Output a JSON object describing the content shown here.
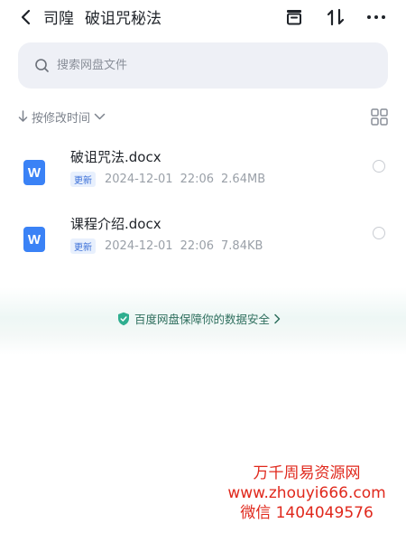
{
  "header": {
    "title_parts": [
      "司隍",
      "破诅咒秘法"
    ],
    "icons": [
      "back-icon",
      "archive-box-icon",
      "sort-arrows-icon",
      "more-icon"
    ]
  },
  "search": {
    "placeholder": "搜索网盘文件",
    "icon": "search-icon"
  },
  "sort": {
    "label": "按修改时间",
    "icon_left": "down-arrow-icon",
    "icon_right": "chevron-down-icon",
    "view_toggle_icon": "grid-view-icon"
  },
  "files": [
    {
      "name": "破诅咒法.docx",
      "badge": "更新",
      "date": "2024-12-01",
      "time": "22:06",
      "size": "2.64MB",
      "icon": "word-doc-icon",
      "icon_letter": "W"
    },
    {
      "name": "课程介绍.docx",
      "badge": "更新",
      "date": "2024-12-01",
      "time": "22:06",
      "size": "7.84KB",
      "icon": "word-doc-icon",
      "icon_letter": "W"
    }
  ],
  "safety": {
    "text": "百度网盘保障你的数据安全",
    "icon": "shield-check-icon"
  },
  "watermark": {
    "line1": "万千周易资源网",
    "line2": "www.zhouyi666.com",
    "line3": "微信 1404049576"
  },
  "colors": {
    "accent": "#3a82f6",
    "badge_text": "#3a6fd8",
    "safety_text": "#2f6f5e",
    "watermark": "#e0281c"
  }
}
